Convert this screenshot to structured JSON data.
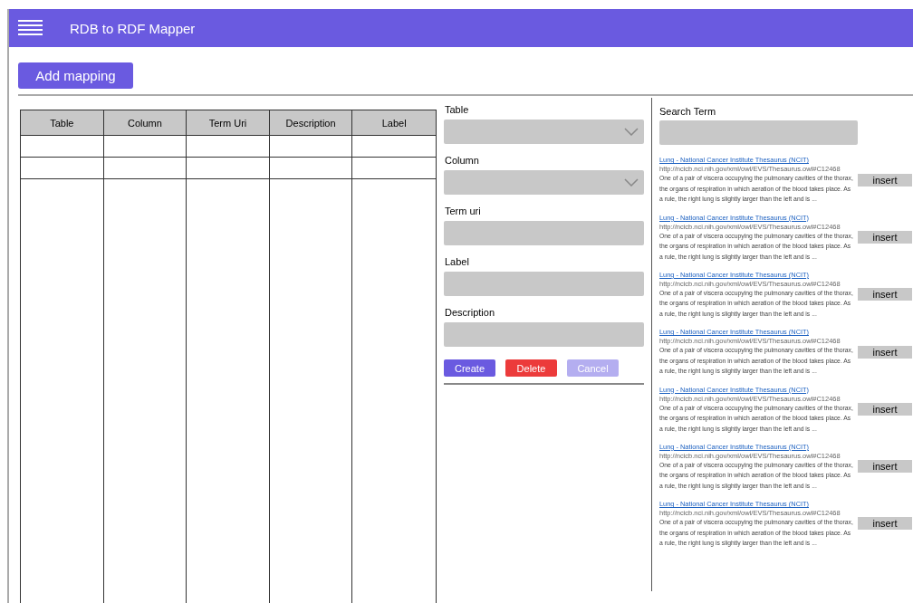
{
  "app_bar": {
    "title": "RDB to RDF Mapper"
  },
  "add_button": "Add mapping",
  "table": {
    "columns": [
      "Table",
      "Column",
      "Term Uri",
      "Description",
      "Label"
    ],
    "rows": [
      [
        "",
        "",
        "",
        "",
        ""
      ],
      [
        "",
        "",
        "",
        "",
        ""
      ],
      [
        "",
        "",
        "",
        "",
        ""
      ]
    ]
  },
  "form": {
    "fields": [
      {
        "label": "Table",
        "kind": "select"
      },
      {
        "label": "Column",
        "kind": "select"
      },
      {
        "label": "Term uri",
        "kind": "text"
      },
      {
        "label": "Label",
        "kind": "text"
      },
      {
        "label": "Description",
        "kind": "text"
      }
    ],
    "buttons": [
      {
        "label": "Create",
        "kind": "primary",
        "disabled": false
      },
      {
        "label": "Delete",
        "kind": "danger",
        "disabled": false
      },
      {
        "label": "Cancel",
        "kind": "primary",
        "disabled": true
      }
    ]
  },
  "search": {
    "label": "Search Term",
    "results": [
      {
        "title": "Lung - National Cancer Institute Thesaurus (NCIT)",
        "url": "http://ncicb.nci.nih.gov/xml/owl/EVS/Thesaurus.owl#C12468",
        "description": "One of a pair of viscera occupying the pulmonary cavities of the thorax, the organs of respiration in which aeration of the blood takes place. As a rule, the right lung is slightly larger than the left and is ...",
        "button": "insert"
      },
      {
        "title": "Lung - National Cancer Institute Thesaurus (NCIT)",
        "url": "http://ncicb.nci.nih.gov/xml/owl/EVS/Thesaurus.owl#C12468",
        "description": "One of a pair of viscera occupying the pulmonary cavities of the thorax, the organs of respiration in which aeration of the blood takes place. As a rule, the right lung is slightly larger than the left and is ...",
        "button": "insert"
      },
      {
        "title": "Lung - National Cancer Institute Thesaurus (NCIT)",
        "url": "http://ncicb.nci.nih.gov/xml/owl/EVS/Thesaurus.owl#C12468",
        "description": "One of a pair of viscera occupying the pulmonary cavities of the thorax, the organs of respiration in which aeration of the blood takes place. As a rule, the right lung is slightly larger than the left and is ...",
        "button": "insert"
      },
      {
        "title": "Lung - National Cancer Institute Thesaurus (NCIT)",
        "url": "http://ncicb.nci.nih.gov/xml/owl/EVS/Thesaurus.owl#C12468",
        "description": "One of a pair of viscera occupying the pulmonary cavities of the thorax, the organs of respiration in which aeration of the blood takes place. As a rule, the right lung is slightly larger than the left and is ...",
        "button": "insert"
      },
      {
        "title": "Lung - National Cancer Institute Thesaurus (NCIT)",
        "url": "http://ncicb.nci.nih.gov/xml/owl/EVS/Thesaurus.owl#C12468",
        "description": "One of a pair of viscera occupying the pulmonary cavities of the thorax, the organs of respiration in which aeration of the blood takes place. As a rule, the right lung is slightly larger than the left and is ...",
        "button": "insert"
      },
      {
        "title": "Lung - National Cancer Institute Thesaurus (NCIT)",
        "url": "http://ncicb.nci.nih.gov/xml/owl/EVS/Thesaurus.owl#C12468",
        "description": "One of a pair of viscera occupying the pulmonary cavities of the thorax, the organs of respiration in which aeration of the blood takes place. As a rule, the right lung is slightly larger than the left and is ...",
        "button": "insert"
      },
      {
        "title": "Lung - National Cancer Institute Thesaurus (NCIT)",
        "url": "http://ncicb.nci.nih.gov/xml/owl/EVS/Thesaurus.owl#C12468",
        "description": "One of a pair of viscera occupying the pulmonary cavities of the thorax, the organs of respiration in which aeration of the blood takes place. As a rule, the right lung is slightly larger than the left and is ...",
        "button": "insert"
      }
    ]
  }
}
